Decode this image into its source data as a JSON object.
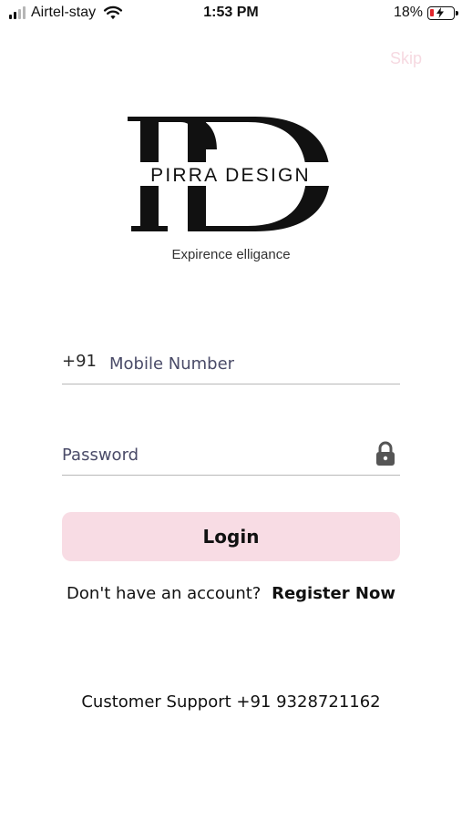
{
  "status_bar": {
    "carrier": "Airtel-stay",
    "time": "1:53 PM",
    "battery_percent": "18%",
    "battery_level": 0.18,
    "battery_color": "#e2262c"
  },
  "header": {
    "skip_label": "Skip"
  },
  "brand": {
    "monogram": "PD",
    "name": "PIRRA DESIGN",
    "tagline": "Expirence elligance"
  },
  "form": {
    "country_code": "+91",
    "mobile_placeholder": "Mobile Number",
    "mobile_value": "",
    "password_placeholder": "Password",
    "password_value": "",
    "password_icon": "lock-icon",
    "login_label": "Login",
    "login_color": "#f8dce4"
  },
  "register": {
    "question": "Don't have an account?",
    "link_label": "Register Now"
  },
  "footer": {
    "support_text": "Customer Support +91 9328721162"
  }
}
